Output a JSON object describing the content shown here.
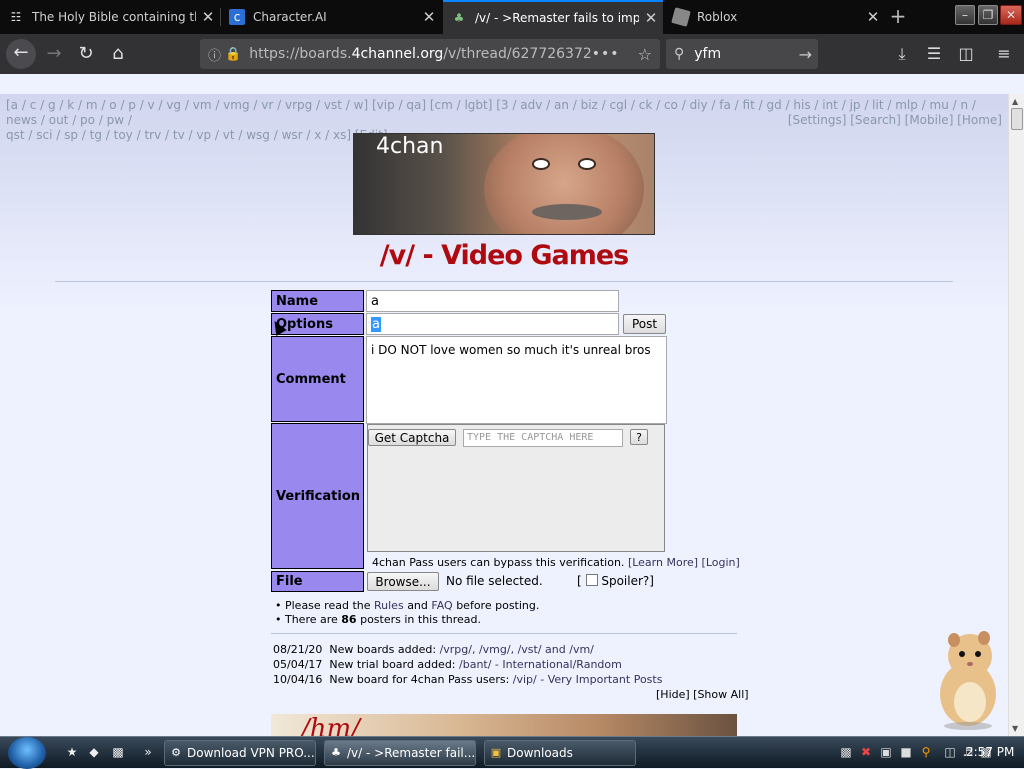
{
  "browser": {
    "tabs": [
      {
        "icon": "bible-icon",
        "title": "The Holy Bible containing the"
      },
      {
        "icon": "character-ai-icon",
        "title": "Character.AI"
      },
      {
        "icon": "fourchan-icon",
        "title": "/v/ - >Remaster fails to impro"
      },
      {
        "icon": "roblox-icon",
        "title": "Roblox"
      }
    ],
    "url_prefix": "https://boards.",
    "url_domain": "4channel.org",
    "url_path": "/v/thread/627726372",
    "search_value": "yfm"
  },
  "page": {
    "board_nav": "[a / c / g / k / m / o / p / v / vg / vm / vmg / vr / vrpg / vst / w] [vip / qa] [cm / lgbt] [3 / adv / an / biz / cgl / ck / co / diy / fa / fit / gd / his / int / jp / lit / mlp / mu / n / news / out / po / pw /",
    "board_nav_2": "qst / sci / sp / tg / toy / trv / tv / vp / vt / wsg / wsr / x / xs] [Edit]",
    "board_nav_right": "[Settings] [Search] [Mobile] [Home]",
    "banner_label": "4chan",
    "board_title": "/v/ - Video Games",
    "form": {
      "name_label": "Name",
      "name_value": "a",
      "options_label": "Options",
      "options_value": "a",
      "post_button": "Post",
      "comment_label": "Comment",
      "comment_value": "i DO NOT love women so much it's unreal bros",
      "verification_label": "Verification",
      "get_captcha_button": "Get Captcha",
      "captcha_placeholder": "TYPE THE CAPTCHA HERE",
      "captcha_help": "?",
      "pass_text": "4chan Pass users can bypass this verification.",
      "learn_more": "[Learn More]",
      "login": "[Login]",
      "file_label": "File",
      "browse_button": "Browse...",
      "file_status": "No file selected.",
      "spoiler_open": "[",
      "spoiler_label": "Spoiler?]"
    },
    "notes": {
      "rules_pre": "• Please read the",
      "rules_link": "Rules",
      "rules_and": "and",
      "faq_link": "FAQ",
      "rules_post": "before posting.",
      "posters_pre": "• There are",
      "posters_count": "86",
      "posters_post": "posters in this thread."
    },
    "news": [
      {
        "date": "08/21/20",
        "text": "New boards added:",
        "links": "/vrpg/, /vmg/, /vst/ and /vm/"
      },
      {
        "date": "05/04/17",
        "text": "New trial board added:",
        "links": "/bant/ - International/Random"
      },
      {
        "date": "10/04/16",
        "text": "New board for 4chan Pass users:",
        "links": "/vip/ - Very Important Posts"
      }
    ],
    "news_controls": "[Hide] [Show All]",
    "bottom_banner_text": "/hm/"
  },
  "taskbar": {
    "items": [
      {
        "label": "Download VPN PRO..."
      },
      {
        "label": "/v/ - >Remaster fail..."
      },
      {
        "label": "Downloads"
      }
    ],
    "clock": "2:57 PM"
  },
  "colors": {
    "board_title": "#af0a0f",
    "label_bg": "#9988ee",
    "link": "#34345c"
  }
}
